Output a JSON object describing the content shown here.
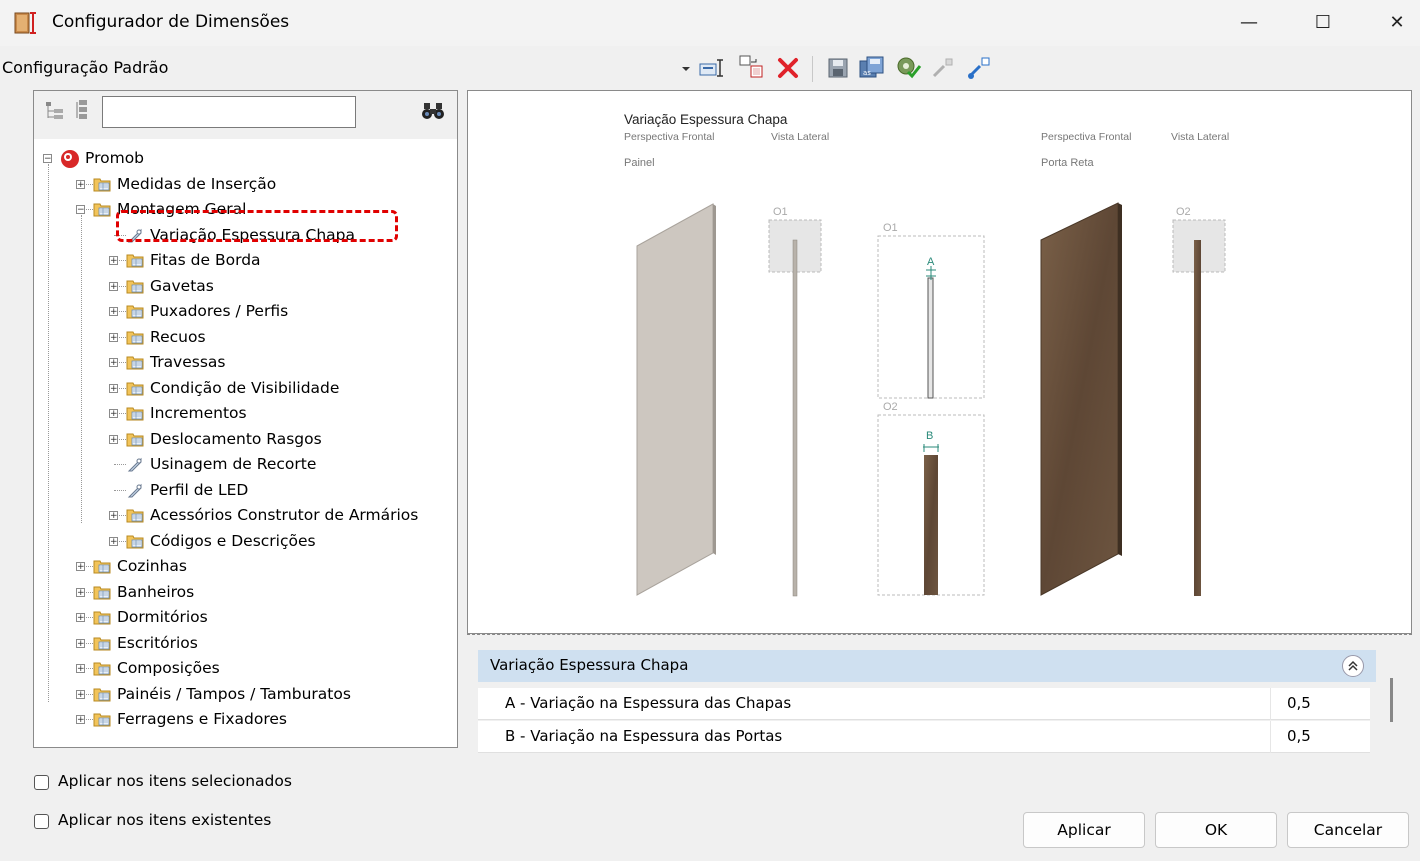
{
  "window": {
    "title": "Configurador de Dimensões",
    "minimize": "—",
    "maximize": "☐",
    "close": "✕"
  },
  "config": {
    "label": "Configuração Padrão"
  },
  "search": {
    "value": "",
    "placeholder": ""
  },
  "tree": {
    "root": "Promob",
    "items": [
      {
        "label": "Medidas de Inserção",
        "level": 1,
        "type": "folder",
        "expandable": true
      },
      {
        "label": "Montagem Geral",
        "level": 1,
        "type": "folder",
        "expandable": true,
        "expanded": true
      },
      {
        "label": "Variação Espessura Chapa",
        "level": 2,
        "type": "leaf",
        "selected": true
      },
      {
        "label": "Fitas de Borda",
        "level": 2,
        "type": "folder",
        "expandable": true
      },
      {
        "label": "Gavetas",
        "level": 2,
        "type": "folder",
        "expandable": true
      },
      {
        "label": "Puxadores / Perfis",
        "level": 2,
        "type": "folder",
        "expandable": true
      },
      {
        "label": "Recuos",
        "level": 2,
        "type": "folder",
        "expandable": true
      },
      {
        "label": "Travessas",
        "level": 2,
        "type": "folder",
        "expandable": true
      },
      {
        "label": "Condição de Visibilidade",
        "level": 2,
        "type": "folder",
        "expandable": true
      },
      {
        "label": "Incrementos",
        "level": 2,
        "type": "folder",
        "expandable": true
      },
      {
        "label": "Deslocamento Rasgos",
        "level": 2,
        "type": "folder",
        "expandable": true
      },
      {
        "label": "Usinagem de Recorte",
        "level": 2,
        "type": "leaf"
      },
      {
        "label": "Perfil de LED",
        "level": 2,
        "type": "leaf"
      },
      {
        "label": "Acessórios Construtor de Armários",
        "level": 2,
        "type": "folder",
        "expandable": true
      },
      {
        "label": "Códigos e Descrições",
        "level": 2,
        "type": "folder",
        "expandable": true
      },
      {
        "label": "Cozinhas",
        "level": 1,
        "type": "folder",
        "expandable": true
      },
      {
        "label": "Banheiros",
        "level": 1,
        "type": "folder",
        "expandable": true
      },
      {
        "label": "Dormitórios",
        "level": 1,
        "type": "folder",
        "expandable": true
      },
      {
        "label": "Escritórios",
        "level": 1,
        "type": "folder",
        "expandable": true
      },
      {
        "label": "Composições",
        "level": 1,
        "type": "folder",
        "expandable": true
      },
      {
        "label": "Painéis / Tampos / Tamburatos",
        "level": 1,
        "type": "folder",
        "expandable": true
      },
      {
        "label": "Ferragens e Fixadores",
        "level": 1,
        "type": "folder",
        "expandable": true
      }
    ]
  },
  "preview": {
    "title": "Variação Espessura Chapa",
    "left_persp": "Perspectiva Frontal",
    "left_side": "Vista Lateral",
    "left_name": "Painel",
    "right_persp": "Perspectiva Frontal",
    "right_side": "Vista Lateral",
    "right_name": "Porta Reta",
    "o1a": "O1",
    "o1b": "O1",
    "o2a": "O2",
    "o2b": "O2",
    "dim_a": "A",
    "dim_b": "B"
  },
  "properties": {
    "section": "Variação Espessura Chapa",
    "rows": [
      {
        "label": "A - Variação na Espessura das Chapas",
        "value": "0,5"
      },
      {
        "label": "B - Variação na Espessura das Portas",
        "value": "0,5"
      }
    ]
  },
  "options": {
    "apply_selected": "Aplicar nos itens selecionados",
    "apply_existing": "Aplicar nos itens existentes"
  },
  "buttons": {
    "apply": "Aplicar",
    "ok": "OK",
    "cancel": "Cancelar"
  },
  "colors": {
    "highlight": "#e00000",
    "section_header": "#cfe0f0",
    "wood": "#6b5340",
    "panel": "#cfc9c2"
  }
}
